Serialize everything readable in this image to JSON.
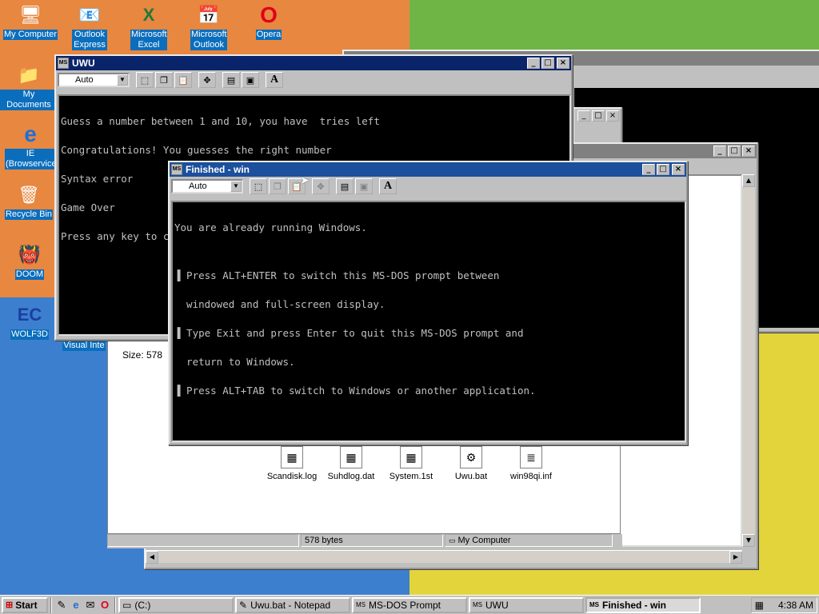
{
  "desktop": {
    "icons": [
      {
        "label": "My Computer",
        "icon": "computer-icon"
      },
      {
        "label": "Outlook Express",
        "icon": "outlook-express-icon"
      },
      {
        "label": "Microsoft Excel",
        "icon": "excel-icon"
      },
      {
        "label": "Microsoft Outlook",
        "icon": "outlook-icon"
      },
      {
        "label": "Opera",
        "icon": "opera-icon"
      },
      {
        "label": "My Documents",
        "icon": "folder-icon"
      },
      {
        "label": "IE (Browservice)",
        "icon": "ie-icon"
      },
      {
        "label": "Recycle Bin",
        "icon": "recycle-bin-icon"
      },
      {
        "label": "DOOM",
        "icon": "doom-icon"
      },
      {
        "label": "WOLF3D",
        "icon": "wolf3d-icon"
      },
      {
        "label": "Visual Inte",
        "icon": "visual-icon"
      }
    ]
  },
  "explorer": {
    "size_label": "Size: 578",
    "files": [
      {
        "name": "Scandisk.log",
        "icon": "log-file-icon"
      },
      {
        "name": "Suhdlog.dat",
        "icon": "dat-file-icon"
      },
      {
        "name": "System.1st",
        "icon": "system-file-icon"
      },
      {
        "name": "Uwu.bat",
        "icon": "batch-file-icon"
      },
      {
        "name": "win98qi.inf",
        "icon": "inf-file-icon"
      }
    ],
    "status_size": "578 bytes",
    "status_location": "My Computer"
  },
  "uwu_window": {
    "title": "UWU",
    "font_select": "Auto",
    "console_lines": [
      "Guess a number between 1 and 10, you have  tries left",
      "Congratulations! You guesses the right number",
      "Syntax error",
      "Game Over",
      "Press any key to continue . . ."
    ]
  },
  "finished_window": {
    "title": "Finished - win",
    "font_select": "Auto",
    "console_lines": [
      "You are already running Windows.",
      "",
      "▐ Press ALT+ENTER to switch this MS-DOS prompt between",
      "  windowed and full-screen display.",
      "▐ Type Exit and press Enter to quit this MS-DOS prompt and",
      "  return to Windows.",
      "▐ Press ALT+TAB to switch to Windows or another application."
    ]
  },
  "taskbar": {
    "start_label": "Start",
    "tasks": [
      {
        "label": "(C:)",
        "icon": "drive-icon"
      },
      {
        "label": "Uwu.bat - Notepad",
        "icon": "notepad-icon"
      },
      {
        "label": "MS-DOS Prompt",
        "icon": "msdos-icon"
      },
      {
        "label": "UWU",
        "icon": "msdos-icon"
      },
      {
        "label": "Finished - win",
        "icon": "msdos-icon"
      }
    ],
    "clock": "4:38 AM"
  },
  "colors": {
    "title_active": "#0a246a",
    "title_inactive": "#808080",
    "window_face": "#c0c0c0",
    "console_bg": "#000000",
    "console_fg": "#c0c0c0"
  }
}
